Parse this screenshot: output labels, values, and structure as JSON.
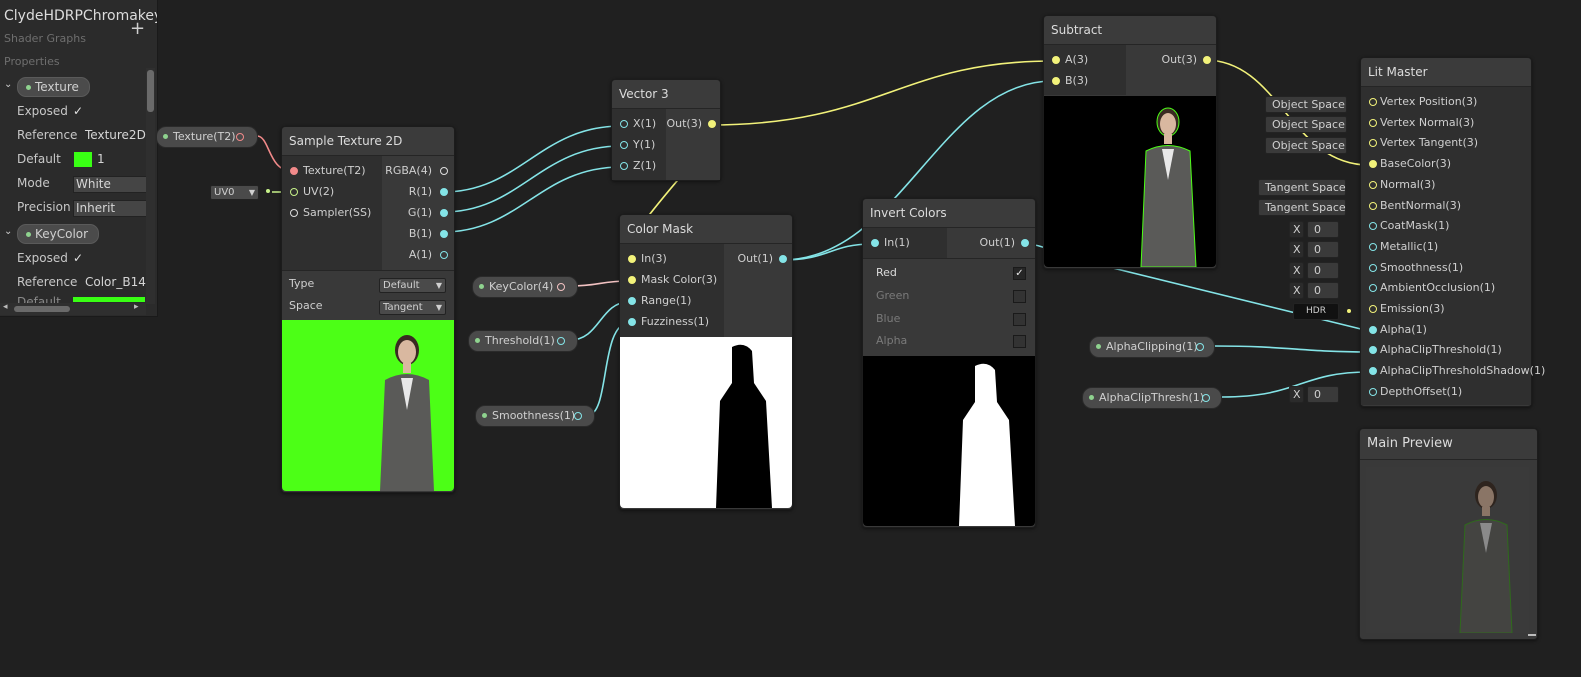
{
  "blackboard": {
    "title": "ClydeHDRPChromakey",
    "subtitle": "Shader Graphs",
    "add_icon": "plus-icon",
    "add_label": "+",
    "section": "Properties",
    "texture_prop": {
      "name": "Texture",
      "exposed_label": "Exposed",
      "exposed_check": "✓",
      "reference_label": "Reference",
      "reference_value": "Texture2D",
      "default_label": "Default",
      "default_value": "1",
      "mode_label": "Mode",
      "mode_value": "White",
      "precision_label": "Precision",
      "precision_value": "Inherit"
    },
    "keycolor_prop": {
      "name": "KeyColor",
      "exposed_label": "Exposed",
      "exposed_check": "✓",
      "reference_label": "Reference",
      "reference_value": "Color_B14",
      "default_label": "Default"
    },
    "colors": {
      "green_swatch": "#39ff14"
    }
  },
  "texture_prop_node": {
    "label": "Texture(T2)"
  },
  "uv_field": {
    "value": "UV0"
  },
  "sample_texture": {
    "title": "Sample Texture 2D",
    "inputs": [
      "Texture(T2)",
      "UV(2)",
      "Sampler(SS)"
    ],
    "outputs": [
      "RGBA(4)",
      "R(1)",
      "G(1)",
      "B(1)",
      "A(1)"
    ],
    "type_label": "Type",
    "type_value": "Default",
    "space_label": "Space",
    "space_value": "Tangent"
  },
  "vector3": {
    "title": "Vector 3",
    "inputs": [
      "X(1)",
      "Y(1)",
      "Z(1)"
    ],
    "output": "Out(3)"
  },
  "color_mask": {
    "title": "Color Mask",
    "inputs": [
      "In(3)",
      "Mask Color(3)",
      "Range(1)",
      "Fuzziness(1)"
    ],
    "output": "Out(1)"
  },
  "keycolor_node": {
    "label": "KeyColor(4)"
  },
  "threshold_node": {
    "label": "Threshold(1)"
  },
  "smoothness_node": {
    "label": "Smoothness(1)"
  },
  "invert_colors": {
    "title": "Invert Colors",
    "input": "In(1)",
    "output": "Out(1)",
    "channels": [
      {
        "label": "Red",
        "checked": "✓"
      },
      {
        "label": "Green",
        "checked": ""
      },
      {
        "label": "Blue",
        "checked": ""
      },
      {
        "label": "Alpha",
        "checked": ""
      }
    ]
  },
  "subtract": {
    "title": "Subtract",
    "inputs": [
      "A(3)",
      "B(3)"
    ],
    "output": "Out(3)"
  },
  "lit_master": {
    "title": "Lit Master",
    "inputs": [
      "Vertex Position(3)",
      "Vertex Normal(3)",
      "Vertex Tangent(3)",
      "BaseColor(3)",
      "Normal(3)",
      "BentNormal(3)",
      "CoatMask(1)",
      "Metallic(1)",
      "Smoothness(1)",
      "AmbientOcclusion(1)",
      "Emission(3)",
      "Alpha(1)",
      "AlphaClipThreshold(1)",
      "AlphaClipThresholdShadow(1)",
      "DepthOffset(1)"
    ],
    "space_fields": [
      "Object Space",
      "Object Space",
      "Object Space"
    ],
    "tangent_fields": [
      "Tangent Space",
      "Tangent Space"
    ],
    "x_label": "X",
    "x_value": "0",
    "hdr_label": "HDR"
  },
  "alphaclipping_node": {
    "label": "AlphaClipping(1)"
  },
  "alphaclipthresh_node": {
    "label": "AlphaClipThresh(1)"
  },
  "main_preview": {
    "title": "Main Preview"
  },
  "colors": {
    "vector": "#f2f27a",
    "float": "#84e4e7",
    "texture": "#f28a8a",
    "uv": "#c7f28a",
    "green_screen": "#4cff16"
  }
}
